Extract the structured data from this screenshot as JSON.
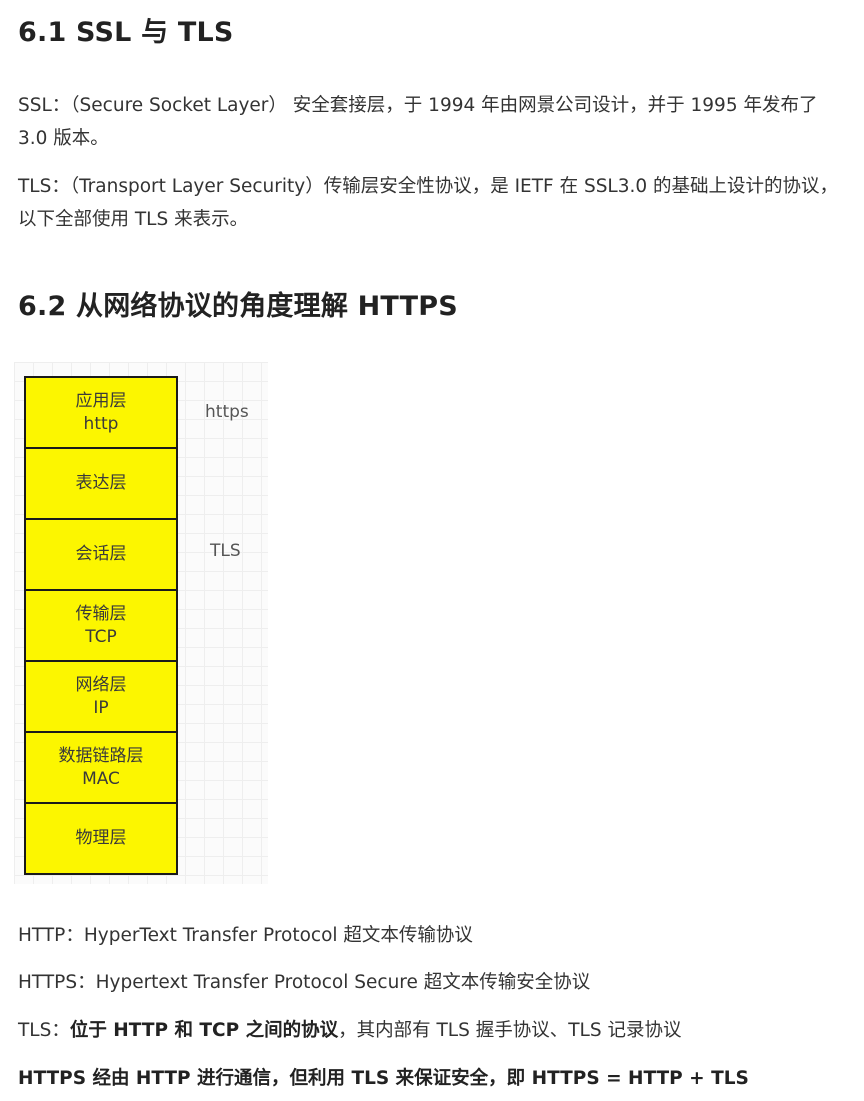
{
  "section1": {
    "heading": "6.1 SSL 与 TLS",
    "ssl_paragraph": "SSL：（Secure Socket Layer） 安全套接层，于 1994 年由网景公司设计，并于 1995 年发布了 3.0 版本。",
    "tls_paragraph": "TLS：（Transport Layer Security）传输层安全性协议，是 IETF 在 SSL3.0 的基础上设计的协议，以下全部使用 TLS 来表示。"
  },
  "section2": {
    "heading": "6.2 从网络协议的角度理解 HTTPS"
  },
  "diagram": {
    "layers": [
      {
        "name": "应用层",
        "sub": "http"
      },
      {
        "name": "表达层",
        "sub": ""
      },
      {
        "name": "会话层",
        "sub": ""
      },
      {
        "name": "传输层",
        "sub": "TCP"
      },
      {
        "name": "网络层",
        "sub": "IP"
      },
      {
        "name": "数据链路层",
        "sub": "MAC"
      },
      {
        "name": "物理层",
        "sub": ""
      }
    ],
    "label_https": "https",
    "label_tls": "TLS",
    "fill_color": "#fcf600"
  },
  "definitions": {
    "http": "HTTP：HyperText Transfer Protocol 超文本传输协议",
    "https": "HTTPS：Hypertext Transfer Protocol Secure 超文本传输安全协议",
    "tls_prefix": "TLS：",
    "tls_bold": "位于 HTTP 和 TCP 之间的协议",
    "tls_rest": "，其内部有 TLS 握手协议、TLS 记录协议",
    "summary": "HTTPS 经由 HTTP 进行通信，但利用 TLS 来保证安全，即 HTTPS = HTTP + TLS"
  }
}
